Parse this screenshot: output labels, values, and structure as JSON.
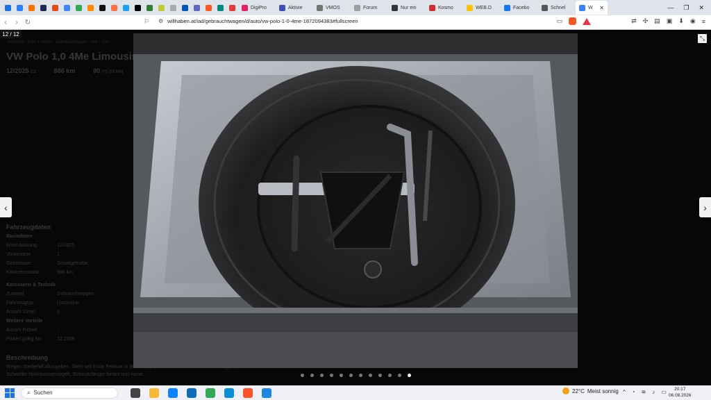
{
  "browser": {
    "tabs": [
      {
        "label": "",
        "color": "#1a73e8"
      },
      {
        "label": "",
        "color": "#2d7ff9"
      },
      {
        "label": "",
        "color": "#ff6f00"
      },
      {
        "label": "",
        "color": "#1d2b53"
      },
      {
        "label": "",
        "color": "#e64a19"
      },
      {
        "label": "",
        "color": "#4285f4"
      },
      {
        "label": "",
        "color": "#34a853"
      },
      {
        "label": "",
        "color": "#ff8a00"
      },
      {
        "label": "",
        "color": "#111111"
      },
      {
        "label": "",
        "color": "#ff7043"
      },
      {
        "label": "",
        "color": "#1da1f2"
      },
      {
        "label": "",
        "color": "#000000"
      },
      {
        "label": "",
        "color": "#2e7d32"
      },
      {
        "label": "",
        "color": "#c0ca33"
      },
      {
        "label": "",
        "color": "#aaaaaa"
      },
      {
        "label": "",
        "color": "#0057b8"
      },
      {
        "label": "",
        "color": "#5c6bc0"
      },
      {
        "label": "",
        "color": "#ff5722"
      },
      {
        "label": "",
        "color": "#00897b"
      },
      {
        "label": "",
        "color": "#e53935"
      },
      {
        "label": "DigiPro",
        "color": "#e91e63"
      },
      {
        "label": "Aktivie",
        "color": "#3f51b5"
      },
      {
        "label": "VMOS",
        "color": "#757575"
      },
      {
        "label": "Forum",
        "color": "#9e9e9e"
      },
      {
        "label": "Nur ein",
        "color": "#333333"
      },
      {
        "label": "Kosmo",
        "color": "#d32f2f"
      },
      {
        "label": "WEB.D",
        "color": "#ffc107"
      },
      {
        "label": "Facebo",
        "color": "#1877f2"
      },
      {
        "label": "Schnel",
        "color": "#555555"
      }
    ],
    "active_tab": {
      "label": "W",
      "color": "#3b82f6"
    },
    "tab_close": "✕",
    "url": "willhaben.at/iad/gebrauchtwagen/d/auto/vw-polo-1-0-4me-1872094383#fullscreen"
  },
  "viewer": {
    "counter": "12 / 12",
    "total_images": 12,
    "current_index": 12
  },
  "background_page": {
    "breadcrumb": "Startseite › Auto & Motor › Gebrauchtwagen › VW › Polo",
    "title": "VW Polo 1,0 4Me Limousine",
    "reg": "12/2025",
    "reg_label": "EZ",
    "km": "886 km",
    "power": "80",
    "power_unit": "PS (59 kW)",
    "section": "Fahrzeugdaten",
    "groups": [
      {
        "heading": "Basisdaten",
        "rows": [
          [
            "Erstzulassung",
            "12/2025"
          ],
          [
            "Vorbesitzer",
            "1"
          ],
          [
            "Getriebeart",
            "Schaltgetriebe"
          ],
          [
            "Kilometerstand",
            "886 km"
          ]
        ]
      },
      {
        "heading": "Karosserie & Technik",
        "rows": [
          [
            "Zustand",
            "Gebrauchtwagen"
          ],
          [
            "Fahrzeugtyp",
            "Limousine"
          ],
          [
            "Anzahl Türen",
            "5"
          ]
        ]
      },
      {
        "heading": "Weitere Vorteile",
        "rows": [
          [
            "Anzahl Pickerl",
            "-"
          ],
          [
            "Pickerl gültig bis",
            "12.2028"
          ]
        ]
      }
    ],
    "description_heading": "Beschreibung",
    "description": "Wegen Sterbefall abzugeben. Steht seit Ende Februar in der Garage, letzte Fahrt... Unterboden versiegelt, beide Schweller hohlraumversiegelt, Schmutzfänger hinten und vorne."
  },
  "taskbar": {
    "search_placeholder": "Suchen",
    "apps": [
      {
        "name": "task-view",
        "color": "#444444"
      },
      {
        "name": "file-explorer",
        "color": "#f9b934"
      },
      {
        "name": "store",
        "color": "#0a84ff"
      },
      {
        "name": "outlook",
        "color": "#0f6cbd"
      },
      {
        "name": "chrome",
        "color": "#34a853"
      },
      {
        "name": "edge",
        "color": "#0c8ddb"
      },
      {
        "name": "brave",
        "color": "#fb542b"
      },
      {
        "name": "app-blue",
        "color": "#1e88e5"
      }
    ],
    "weather_temp": "22°C",
    "weather_text": "Meist sonnig",
    "time": "20:17",
    "date": "06.08.2026"
  }
}
